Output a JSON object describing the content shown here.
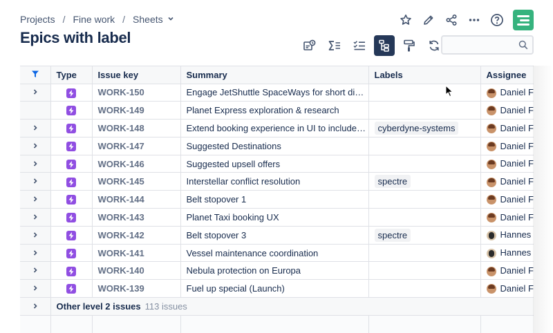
{
  "breadcrumb": {
    "projects": "Projects",
    "sep": "/",
    "project": "Fine work",
    "view": "Sheets"
  },
  "page_title": "Epics with label",
  "search": {
    "placeholder": "",
    "value": ""
  },
  "columns": {
    "type": "Type",
    "key": "Issue key",
    "summary": "Summary",
    "labels": "Labels",
    "assignee": "Assignee"
  },
  "rows": [
    {
      "key": "WORK-150",
      "summary": "Engage JetShuttle SpaceWays for short distance space travel",
      "label": "",
      "assignee": "Daniel Fr",
      "avatar": "a1",
      "expandable": true
    },
    {
      "key": "WORK-149",
      "summary": "Planet Express exploration & research",
      "label": "",
      "assignee": "Daniel Fr",
      "avatar": "a1",
      "expandable": false
    },
    {
      "key": "WORK-148",
      "summary": "Extend booking experience in UI to include more destinations",
      "label": "cyberdyne-systems",
      "assignee": "Daniel Fr",
      "avatar": "a1",
      "expandable": true
    },
    {
      "key": "WORK-147",
      "summary": "Suggested Destinations",
      "label": "",
      "assignee": "Daniel Fr",
      "avatar": "a1",
      "expandable": true
    },
    {
      "key": "WORK-146",
      "summary": "Suggested upsell offers",
      "label": "",
      "assignee": "Daniel Fr",
      "avatar": "a1",
      "expandable": true
    },
    {
      "key": "WORK-145",
      "summary": "Interstellar conflict resolution",
      "label": "spectre",
      "assignee": "Daniel Fr",
      "avatar": "a1",
      "expandable": true
    },
    {
      "key": "WORK-144",
      "summary": "Belt stopover 1",
      "label": "",
      "assignee": "Daniel Fr",
      "avatar": "a1",
      "expandable": true
    },
    {
      "key": "WORK-143",
      "summary": "Planet Taxi booking UX",
      "label": "",
      "assignee": "Daniel Fr",
      "avatar": "a1",
      "expandable": true
    },
    {
      "key": "WORK-142",
      "summary": "Belt stopover 3",
      "label": "spectre",
      "assignee": "Hannes (",
      "avatar": "a2",
      "expandable": true
    },
    {
      "key": "WORK-141",
      "summary": "Vessel maintenance coordination",
      "label": "",
      "assignee": "Hannes (",
      "avatar": "a2",
      "expandable": true
    },
    {
      "key": "WORK-140",
      "summary": "Nebula protection on Europa",
      "label": "",
      "assignee": "Daniel Fr",
      "avatar": "a1",
      "expandable": true
    },
    {
      "key": "WORK-139",
      "summary": "Fuel up special (Launch)",
      "label": "",
      "assignee": "Daniel Fr",
      "avatar": "a1",
      "expandable": true
    }
  ],
  "footer": {
    "label": "Other level 2 issues",
    "count": "113 issues"
  },
  "icons": {
    "top": [
      "star-icon",
      "pencil-icon",
      "share-icon",
      "more-icon",
      "help-icon",
      "app-logo-icon"
    ],
    "toolbar": [
      "filter-list-icon",
      "sum-icon",
      "checklist-icon",
      "hierarchy-icon",
      "paint-roller-icon",
      "refresh-icon"
    ],
    "search": "search-icon",
    "filter_header": "filter-icon",
    "issue_type": "epic-icon"
  },
  "colors": {
    "epic": "#904ee2",
    "active_tool": "#253858",
    "logo": "#36b37e",
    "filter": "#0c66e4"
  }
}
